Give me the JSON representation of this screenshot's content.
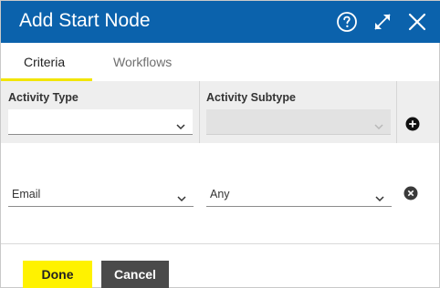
{
  "dialog": {
    "title": "Add Start Node",
    "icons": [
      "help-circle-icon",
      "expand-icon",
      "close-icon"
    ]
  },
  "tabs": [
    {
      "label": "Criteria",
      "active": true
    },
    {
      "label": "Workflows",
      "active": false
    }
  ],
  "table": {
    "columns": [
      "Activity Type",
      "Activity Subtype"
    ],
    "new_row": {
      "activity_type": "",
      "activity_subtype": "",
      "subtype_disabled": true
    },
    "rows": [
      {
        "activity_type": "Email",
        "activity_subtype": "Any"
      }
    ]
  },
  "footer": {
    "done_label": "Done",
    "cancel_label": "Cancel"
  },
  "colors": {
    "titlebar": "#0b62ac",
    "accent": "#fff200",
    "cancel": "#4a4a4a"
  }
}
